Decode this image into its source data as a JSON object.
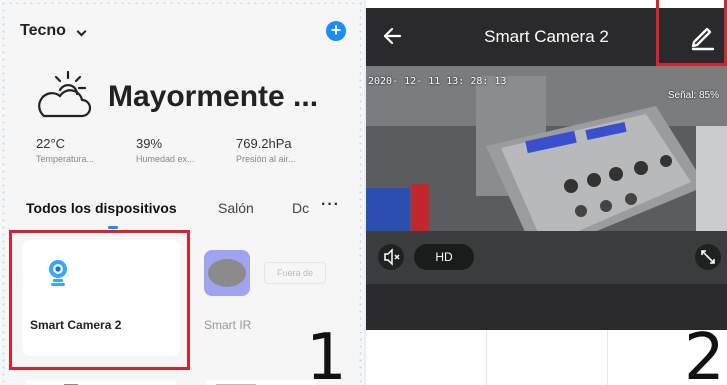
{
  "left_panel": {
    "home_name": "Tecno",
    "add_icon": "plus-circle-icon",
    "weather": {
      "icon": "cloud-sun-icon",
      "title": "Mayormente ...",
      "stats": [
        {
          "value": "22°C",
          "label": "Temperatura..."
        },
        {
          "value": "39%",
          "label": "Humedad ex..."
        },
        {
          "value": "769.2hPa",
          "label": "Presión al air..."
        }
      ]
    },
    "tabs": [
      {
        "label": "Todos los dispositivos",
        "active": true
      },
      {
        "label": "Salón",
        "active": false
      },
      {
        "label": "Dc",
        "active": false
      }
    ],
    "devices": [
      {
        "name": "Smart Camera 2",
        "icon": "camera-icon"
      },
      {
        "name": "Smart IR",
        "icon": "ir-remote-icon",
        "status": "Fuera de"
      }
    ],
    "step_label": "1"
  },
  "right_panel": {
    "title": "Smart Camera 2",
    "timestamp": "2020- 12- 11  13: 28: 13",
    "signal": "Señal: 85%",
    "quality": "HD",
    "step_label": "2"
  },
  "colors": {
    "accent": "#1a8cff",
    "highlight": "#d7232d",
    "camera_bg": "#2a2a2c"
  }
}
